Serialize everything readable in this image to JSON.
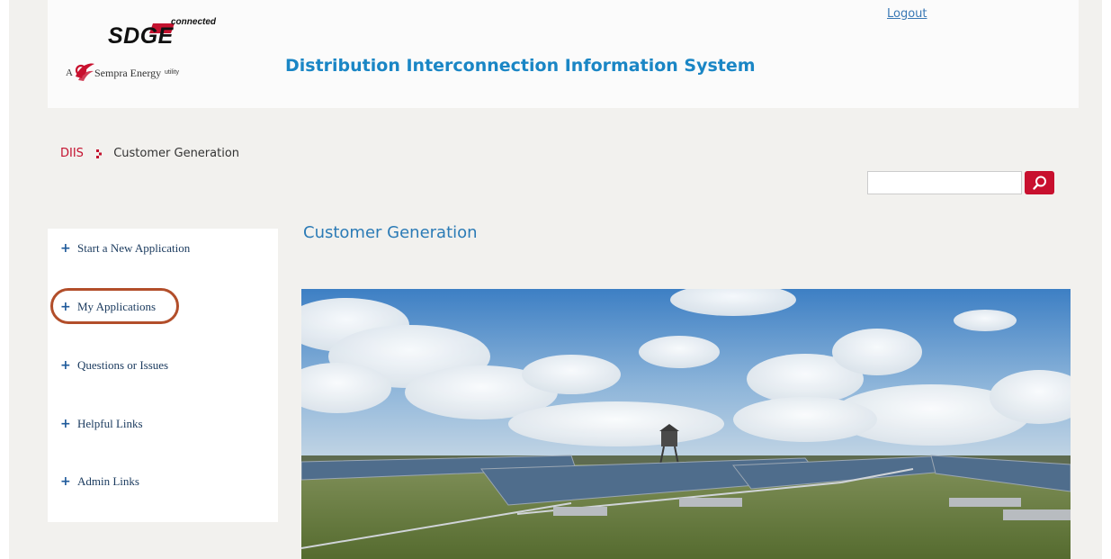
{
  "header": {
    "logo": {
      "brand": "SDGE",
      "tagline": "connected",
      "parent_prefix": "A",
      "parent_name": "Sempra Energy",
      "parent_suffix": "utility"
    },
    "app_title": "Distribution Interconnection Information System",
    "logout_label": "Logout"
  },
  "breadcrumb": {
    "root": "DIIS",
    "current": "Customer Generation"
  },
  "search": {
    "value": "",
    "placeholder": ""
  },
  "sidebar": {
    "items": [
      {
        "label": "Start a New Application"
      },
      {
        "label": "My Applications",
        "highlighted": true
      },
      {
        "label": "Questions or Issues"
      },
      {
        "label": "Helpful Links"
      },
      {
        "label": "Admin Links"
      }
    ]
  },
  "main": {
    "title": "Customer Generation"
  },
  "colors": {
    "brand_red": "#c8102e",
    "link_blue": "#1a86c5",
    "nav_plus": "#1e5a9b",
    "highlight_ring": "#b24e2a",
    "page_background": "#f2f1ee"
  },
  "icons": {
    "search": "search-icon",
    "nav_expand": "plus-icon",
    "breadcrumb_separator": "chevron-right-icon"
  }
}
